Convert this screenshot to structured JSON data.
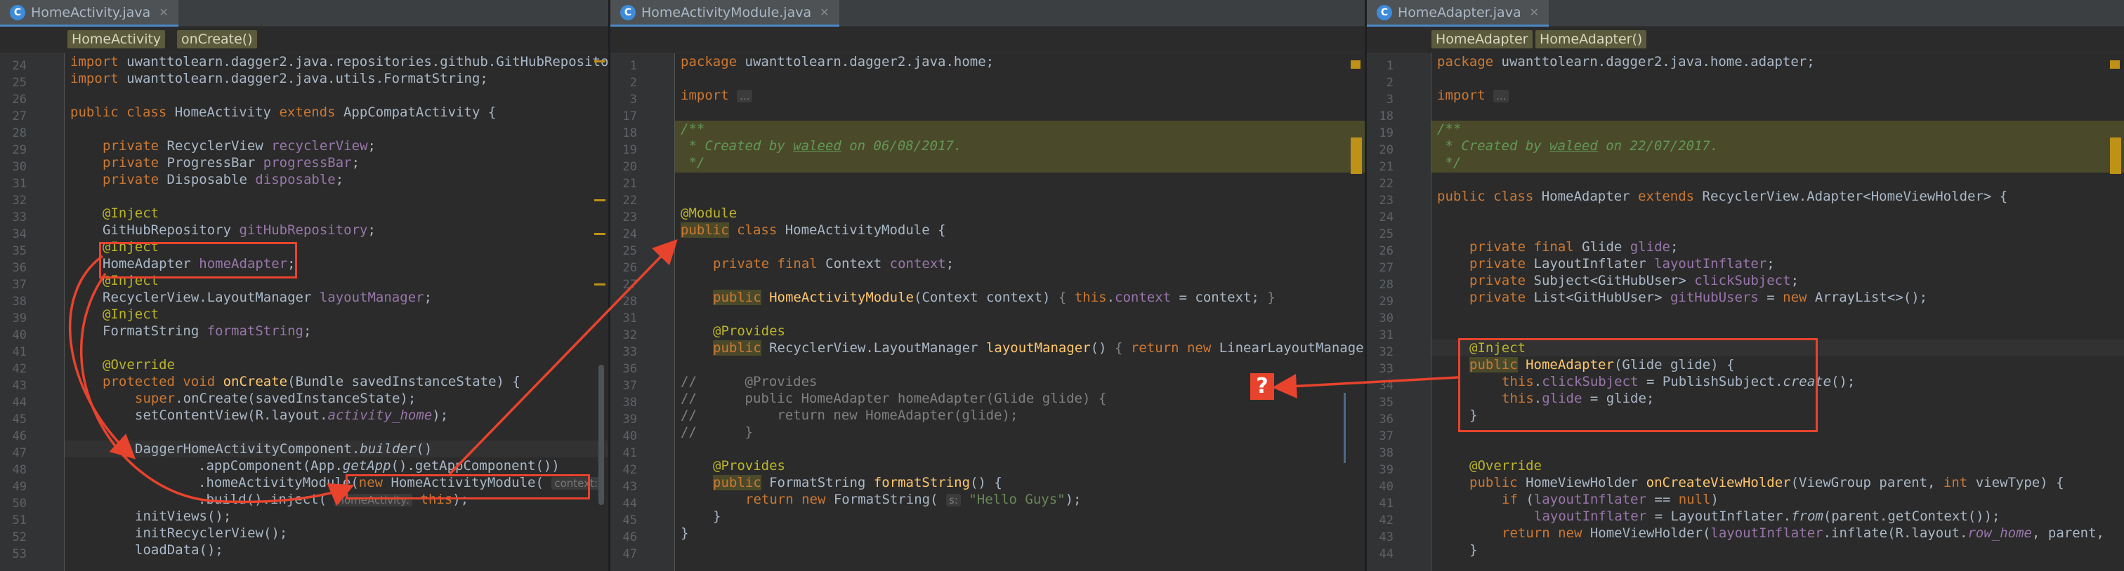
{
  "panes": [
    {
      "tab": "HomeActivity.java",
      "crumbs": [
        "HomeActivity",
        "onCreate()"
      ]
    },
    {
      "tab": "HomeActivityModule.java",
      "crumbs": []
    },
    {
      "tab": "HomeAdapter.java",
      "crumbs": [
        "HomeAdapter",
        "HomeAdapter()"
      ]
    }
  ],
  "left_lines": [
    "24",
    "25",
    "26",
    "27",
    "28",
    "29",
    "30",
    "31",
    "32",
    "33",
    "34",
    "35",
    "36",
    "37",
    "38",
    "39",
    "40",
    "41",
    "42",
    "43",
    "44",
    "45",
    "46",
    "47",
    "48",
    "49",
    "50",
    "51",
    "52",
    "53"
  ],
  "mid_lines": [
    "1",
    "2",
    "3",
    "17",
    "18",
    "19",
    "20",
    "21",
    "22",
    "23",
    "24",
    "25",
    "26",
    "27",
    "28",
    "31",
    "32",
    "33",
    "36",
    "37",
    "38",
    "39",
    "40",
    "41",
    "42",
    "43",
    "44",
    "45",
    "46",
    "47"
  ],
  "right_lines": [
    "1",
    "2",
    "3",
    "18",
    "19",
    "20",
    "21",
    "22",
    "23",
    "24",
    "25",
    "26",
    "27",
    "28",
    "29",
    "30",
    "31",
    "32",
    "33",
    "34",
    "35",
    "36",
    "37",
    "38",
    "39",
    "40",
    "41",
    "42",
    "43",
    "44"
  ],
  "question_mark": "?",
  "colors": {
    "keyword": "#cc7832",
    "field": "#9876aa",
    "annotation": "#bbb529",
    "comment": "#629755",
    "arrow": "#e8432d"
  }
}
